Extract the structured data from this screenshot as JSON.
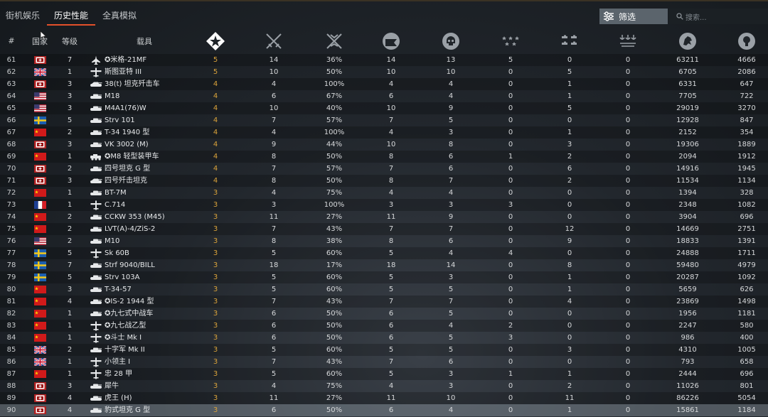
{
  "tabs": [
    {
      "label": "街机娱乐",
      "active": false
    },
    {
      "label": "历史性能",
      "active": true
    },
    {
      "label": "全真模拟",
      "active": false
    }
  ],
  "filter_label": "筛选",
  "search_placeholder": "搜索...",
  "columns": {
    "num": "#",
    "country": "国家",
    "rank": "等级",
    "vehicle": "载具",
    "stat_icons": [
      "battle-rating-icon",
      "kills-crossed-swords-icon",
      "ground-kills-icon",
      "air-kills-icon",
      "deaths-skull-icon",
      "air-units-icon",
      "ground-units-icon",
      "naval-units-icon",
      "lion-icon",
      "research-points-icon"
    ]
  },
  "colors": {
    "accent": "#e3502a",
    "battle_rating": "#d9a23a",
    "selected_row": "#8c96a0"
  },
  "rows": [
    {
      "n": "61",
      "country": "germany",
      "rank": "7",
      "type": "jet",
      "name": "✪米格-21MF",
      "br": "5",
      "s": [
        "14",
        "36%",
        "14",
        "13",
        "5",
        "0",
        "0",
        "63211",
        "4666"
      ]
    },
    {
      "n": "62",
      "country": "uk",
      "rank": "1",
      "type": "plane",
      "name": "斯图亚特 III",
      "br": "5",
      "s": [
        "10",
        "50%",
        "10",
        "10",
        "0",
        "5",
        "0",
        "6705",
        "2086"
      ]
    },
    {
      "n": "63",
      "country": "germany",
      "rank": "3",
      "type": "tank-td",
      "name": "38(t) 坦克歼击车",
      "br": "4",
      "s": [
        "4",
        "100%",
        "4",
        "4",
        "0",
        "1",
        "0",
        "6331",
        "647"
      ]
    },
    {
      "n": "64",
      "country": "usa",
      "rank": "3",
      "type": "tank",
      "name": "M18",
      "br": "4",
      "s": [
        "6",
        "67%",
        "6",
        "4",
        "0",
        "1",
        "0",
        "7705",
        "722"
      ]
    },
    {
      "n": "65",
      "country": "usa",
      "rank": "3",
      "type": "tank",
      "name": "M4A1(76)W",
      "br": "4",
      "s": [
        "10",
        "40%",
        "10",
        "9",
        "0",
        "5",
        "0",
        "29019",
        "3270"
      ]
    },
    {
      "n": "66",
      "country": "sweden",
      "rank": "5",
      "type": "tank",
      "name": "Strv 101",
      "br": "4",
      "s": [
        "7",
        "57%",
        "7",
        "5",
        "0",
        "0",
        "0",
        "12928",
        "847"
      ]
    },
    {
      "n": "67",
      "country": "china",
      "rank": "2",
      "type": "tank",
      "name": "T-34 1940 型",
      "br": "4",
      "s": [
        "4",
        "100%",
        "4",
        "3",
        "0",
        "1",
        "0",
        "2152",
        "354"
      ]
    },
    {
      "n": "68",
      "country": "germany",
      "rank": "3",
      "type": "tank",
      "name": "VK 3002 (M)",
      "br": "4",
      "s": [
        "9",
        "44%",
        "10",
        "8",
        "0",
        "3",
        "0",
        "19306",
        "1889"
      ]
    },
    {
      "n": "69",
      "country": "china",
      "rank": "1",
      "type": "armored-car",
      "name": "✪M8 轻型装甲车",
      "br": "4",
      "s": [
        "8",
        "50%",
        "8",
        "6",
        "1",
        "2",
        "0",
        "2094",
        "1912"
      ]
    },
    {
      "n": "70",
      "country": "germany",
      "rank": "2",
      "type": "tank",
      "name": "四号坦克 G 型",
      "br": "4",
      "s": [
        "7",
        "57%",
        "7",
        "6",
        "0",
        "6",
        "0",
        "14916",
        "1945"
      ]
    },
    {
      "n": "71",
      "country": "germany",
      "rank": "3",
      "type": "tank-td",
      "name": "四号歼击坦克",
      "br": "4",
      "s": [
        "8",
        "50%",
        "8",
        "7",
        "0",
        "2",
        "0",
        "11534",
        "1134"
      ]
    },
    {
      "n": "72",
      "country": "china",
      "rank": "1",
      "type": "tank",
      "name": "BT-7M",
      "br": "3",
      "s": [
        "4",
        "75%",
        "4",
        "4",
        "0",
        "0",
        "0",
        "1394",
        "328"
      ]
    },
    {
      "n": "73",
      "country": "france",
      "rank": "1",
      "type": "plane",
      "name": "C.714",
      "br": "3",
      "s": [
        "3",
        "100%",
        "3",
        "3",
        "3",
        "0",
        "0",
        "2348",
        "1082"
      ]
    },
    {
      "n": "74",
      "country": "china",
      "rank": "2",
      "type": "tank",
      "name": "CCKW 353 (M45)",
      "br": "3",
      "s": [
        "11",
        "27%",
        "11",
        "9",
        "0",
        "0",
        "0",
        "3904",
        "696"
      ]
    },
    {
      "n": "75",
      "country": "china",
      "rank": "2",
      "type": "tank",
      "name": "LVT(A)-4/ZiS-2",
      "br": "3",
      "s": [
        "7",
        "43%",
        "7",
        "7",
        "0",
        "12",
        "0",
        "14669",
        "2751"
      ]
    },
    {
      "n": "76",
      "country": "usa",
      "rank": "2",
      "type": "tank",
      "name": "M10",
      "br": "3",
      "s": [
        "8",
        "38%",
        "8",
        "6",
        "0",
        "9",
        "0",
        "18833",
        "1391"
      ]
    },
    {
      "n": "77",
      "country": "sweden",
      "rank": "5",
      "type": "plane",
      "name": "Sk 60B",
      "br": "3",
      "s": [
        "5",
        "60%",
        "5",
        "4",
        "4",
        "0",
        "0",
        "24888",
        "1711"
      ]
    },
    {
      "n": "78",
      "country": "sweden",
      "rank": "7",
      "type": "tank",
      "name": "Strf 9040/BILL",
      "br": "3",
      "s": [
        "18",
        "17%",
        "18",
        "14",
        "0",
        "8",
        "0",
        "59480",
        "4979"
      ]
    },
    {
      "n": "79",
      "country": "sweden",
      "rank": "5",
      "type": "tank",
      "name": "Strv 103A",
      "br": "3",
      "s": [
        "5",
        "60%",
        "5",
        "3",
        "0",
        "1",
        "0",
        "20287",
        "1092"
      ]
    },
    {
      "n": "80",
      "country": "china",
      "rank": "3",
      "type": "tank",
      "name": "T-34-57",
      "br": "3",
      "s": [
        "5",
        "60%",
        "5",
        "5",
        "0",
        "1",
        "0",
        "5659",
        "626"
      ]
    },
    {
      "n": "81",
      "country": "china",
      "rank": "4",
      "type": "tank",
      "name": "✪IS-2 1944 型",
      "br": "3",
      "s": [
        "7",
        "43%",
        "7",
        "7",
        "0",
        "4",
        "0",
        "23869",
        "1498"
      ]
    },
    {
      "n": "82",
      "country": "china",
      "rank": "1",
      "type": "tank",
      "name": "✪九七式中战车",
      "br": "3",
      "s": [
        "6",
        "50%",
        "6",
        "5",
        "0",
        "0",
        "0",
        "1956",
        "1181"
      ]
    },
    {
      "n": "83",
      "country": "china",
      "rank": "1",
      "type": "plane",
      "name": "✪九七战乙型",
      "br": "3",
      "s": [
        "6",
        "50%",
        "6",
        "4",
        "2",
        "0",
        "0",
        "2247",
        "580"
      ]
    },
    {
      "n": "84",
      "country": "china",
      "rank": "1",
      "type": "plane",
      "name": "✪斗士 Mk I",
      "br": "3",
      "s": [
        "6",
        "50%",
        "6",
        "5",
        "3",
        "0",
        "0",
        "986",
        "400"
      ]
    },
    {
      "n": "85",
      "country": "uk",
      "rank": "2",
      "type": "tank",
      "name": "十字军 Mk II",
      "br": "3",
      "s": [
        "5",
        "60%",
        "5",
        "5",
        "0",
        "3",
        "0",
        "4310",
        "1005"
      ]
    },
    {
      "n": "86",
      "country": "uk",
      "rank": "1",
      "type": "plane",
      "name": "小领主 I",
      "br": "3",
      "s": [
        "7",
        "43%",
        "7",
        "6",
        "0",
        "0",
        "0",
        "793",
        "658"
      ]
    },
    {
      "n": "87",
      "country": "china",
      "rank": "1",
      "type": "plane",
      "name": "忠 28 甲",
      "br": "3",
      "s": [
        "5",
        "60%",
        "5",
        "3",
        "1",
        "1",
        "0",
        "2444",
        "696"
      ]
    },
    {
      "n": "88",
      "country": "germany",
      "rank": "3",
      "type": "tank",
      "name": "犀牛",
      "br": "3",
      "s": [
        "4",
        "75%",
        "4",
        "3",
        "0",
        "2",
        "0",
        "11026",
        "801"
      ]
    },
    {
      "n": "89",
      "country": "germany",
      "rank": "4",
      "type": "tank",
      "name": "虎王 (H)",
      "br": "3",
      "s": [
        "11",
        "27%",
        "11",
        "10",
        "0",
        "11",
        "0",
        "86226",
        "5054"
      ]
    },
    {
      "n": "90",
      "country": "germany",
      "rank": "4",
      "type": "tank",
      "name": "豹式坦克 G 型",
      "br": "3",
      "s": [
        "6",
        "50%",
        "6",
        "4",
        "0",
        "1",
        "0",
        "15861",
        "1184"
      ],
      "selected": true
    }
  ]
}
